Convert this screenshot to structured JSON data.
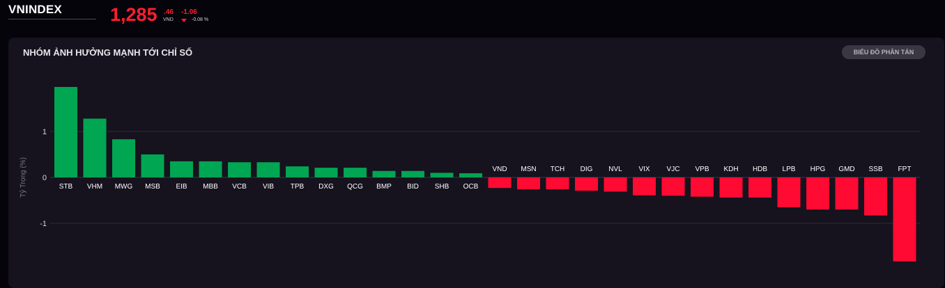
{
  "header": {
    "index_name": "VNINDEX",
    "price_int": "1,285",
    "price_dec": ".46",
    "currency": "VND",
    "change": "-1.06",
    "change_pct": "-0.08 %"
  },
  "panel": {
    "title": "NHÓM ẢNH HƯỞNG MẠNH TỚI CHỈ SỐ",
    "toggle_label": "BIỂU ĐỒ PHÂN TÁN"
  },
  "colors": {
    "positive": "#00a651",
    "negative": "#ff0a32",
    "accent_down": "#ff1e2d"
  },
  "chart_data": {
    "type": "bar",
    "title": "",
    "xlabel": "",
    "ylabel": "Tỷ Trọng (%)",
    "ylim": [
      -1.9,
      2.0
    ],
    "yticks": [
      -1,
      0,
      1
    ],
    "grid": true,
    "categories": [
      "STB",
      "VHM",
      "MWG",
      "MSB",
      "EIB",
      "MBB",
      "VCB",
      "VIB",
      "TPB",
      "DXG",
      "QCG",
      "BMP",
      "BID",
      "SHB",
      "OCB",
      "VND",
      "MSN",
      "TCH",
      "DIG",
      "NVL",
      "VIX",
      "VJC",
      "VPB",
      "KDH",
      "HDB",
      "LPB",
      "HPG",
      "GMD",
      "SSB",
      "FPT"
    ],
    "values": [
      1.97,
      1.28,
      0.83,
      0.5,
      0.35,
      0.35,
      0.33,
      0.33,
      0.24,
      0.21,
      0.21,
      0.14,
      0.14,
      0.1,
      0.09,
      -0.23,
      -0.26,
      -0.26,
      -0.29,
      -0.31,
      -0.39,
      -0.4,
      -0.42,
      -0.44,
      -0.44,
      -0.65,
      -0.7,
      -0.7,
      -0.83,
      -1.83
    ]
  }
}
